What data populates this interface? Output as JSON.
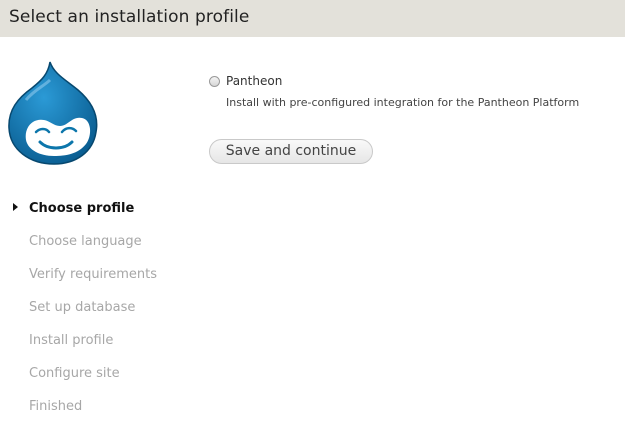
{
  "header": {
    "title": "Select an installation profile"
  },
  "logo": {
    "icon": "drupal-drop-logo",
    "color": "#0c76ab"
  },
  "profile_option": {
    "label": "Pantheon",
    "description": "Install with pre-configured integration for the Pantheon Platform",
    "selected": false
  },
  "actions": {
    "save_label": "Save and continue"
  },
  "steps": {
    "active_index": 0,
    "items": [
      {
        "label": "Choose profile"
      },
      {
        "label": "Choose language"
      },
      {
        "label": "Verify requirements"
      },
      {
        "label": "Set up database"
      },
      {
        "label": "Install profile"
      },
      {
        "label": "Configure site"
      },
      {
        "label": "Finished"
      }
    ]
  }
}
